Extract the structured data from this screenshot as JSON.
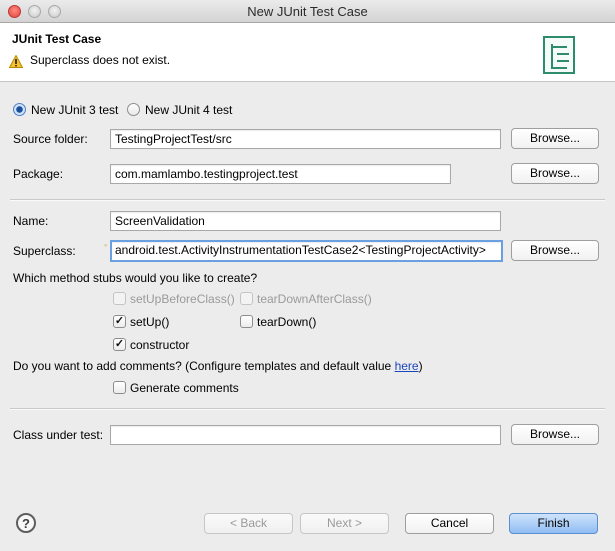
{
  "window": {
    "title": "New JUnit Test Case"
  },
  "header": {
    "title": "JUnit Test Case",
    "message": "Superclass does not exist.",
    "message_icon": "warning-icon",
    "banner_icon": "junit-wizard-icon"
  },
  "version": {
    "options": [
      {
        "label": "New JUnit 3 test",
        "selected": true
      },
      {
        "label": "New JUnit 4 test",
        "selected": false
      }
    ]
  },
  "fields": {
    "source_folder": {
      "label": "Source folder:",
      "value": "TestingProjectTest/src",
      "browse": "Browse..."
    },
    "package": {
      "label": "Package:",
      "value": "com.mamlambo.testingproject.test",
      "browse": "Browse..."
    },
    "name": {
      "label": "Name:",
      "value": "ScreenValidation"
    },
    "superclass": {
      "label": "Superclass:",
      "value": "android.test.ActivityInstrumentationTestCase2<TestingProjectActivity>",
      "browse": "Browse..."
    },
    "class_under_test": {
      "label": "Class under test:",
      "value": "",
      "browse": "Browse..."
    }
  },
  "stubs": {
    "question": "Which method stubs would you like to create?",
    "items": [
      {
        "label": "setUpBeforeClass()",
        "checked": false,
        "enabled": false
      },
      {
        "label": "tearDownAfterClass()",
        "checked": false,
        "enabled": false
      },
      {
        "label": "setUp()",
        "checked": true,
        "enabled": true
      },
      {
        "label": "tearDown()",
        "checked": false,
        "enabled": true
      },
      {
        "label": "constructor",
        "checked": true,
        "enabled": true
      }
    ]
  },
  "comments": {
    "question_prefix": "Do you want to add comments? (Configure templates and default value ",
    "link": "here",
    "question_suffix": ")",
    "generate_label": "Generate comments",
    "generate_checked": false
  },
  "footer": {
    "help": "?",
    "back": "< Back",
    "next": "Next >",
    "cancel": "Cancel",
    "finish": "Finish"
  },
  "check_mark": "✓"
}
